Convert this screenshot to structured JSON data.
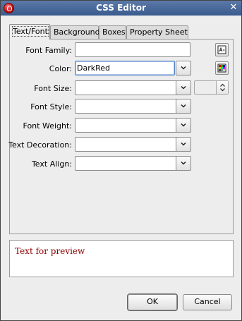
{
  "window": {
    "title": "CSS Editor"
  },
  "tabs": [
    {
      "label": "Text/Font",
      "active": true
    },
    {
      "label": "Background",
      "active": false
    },
    {
      "label": "Boxes",
      "active": false
    },
    {
      "label": "Property Sheet",
      "active": false
    }
  ],
  "form": {
    "font_family": {
      "label": "Font Family:",
      "value": ""
    },
    "color": {
      "label": "Color:",
      "value": "DarkRed"
    },
    "font_size": {
      "label": "Font Size:",
      "value": ""
    },
    "font_style": {
      "label": "Font Style:",
      "value": ""
    },
    "font_weight": {
      "label": "Font Weight:",
      "value": ""
    },
    "text_decoration": {
      "label": "Text Decoration:",
      "value": ""
    },
    "text_align": {
      "label": "Text Align:",
      "value": ""
    }
  },
  "preview": {
    "text": "Text for preview",
    "color": "#8b0000"
  },
  "buttons": {
    "ok": "OK",
    "cancel": "Cancel"
  },
  "icons": {
    "app": "app-icon",
    "close": "close-icon",
    "font_picker": "font-picker-icon",
    "color_picker": "color-picker-icon",
    "dropdown": "chevron-down-icon",
    "spinner": "spinner-arrows-icon"
  }
}
